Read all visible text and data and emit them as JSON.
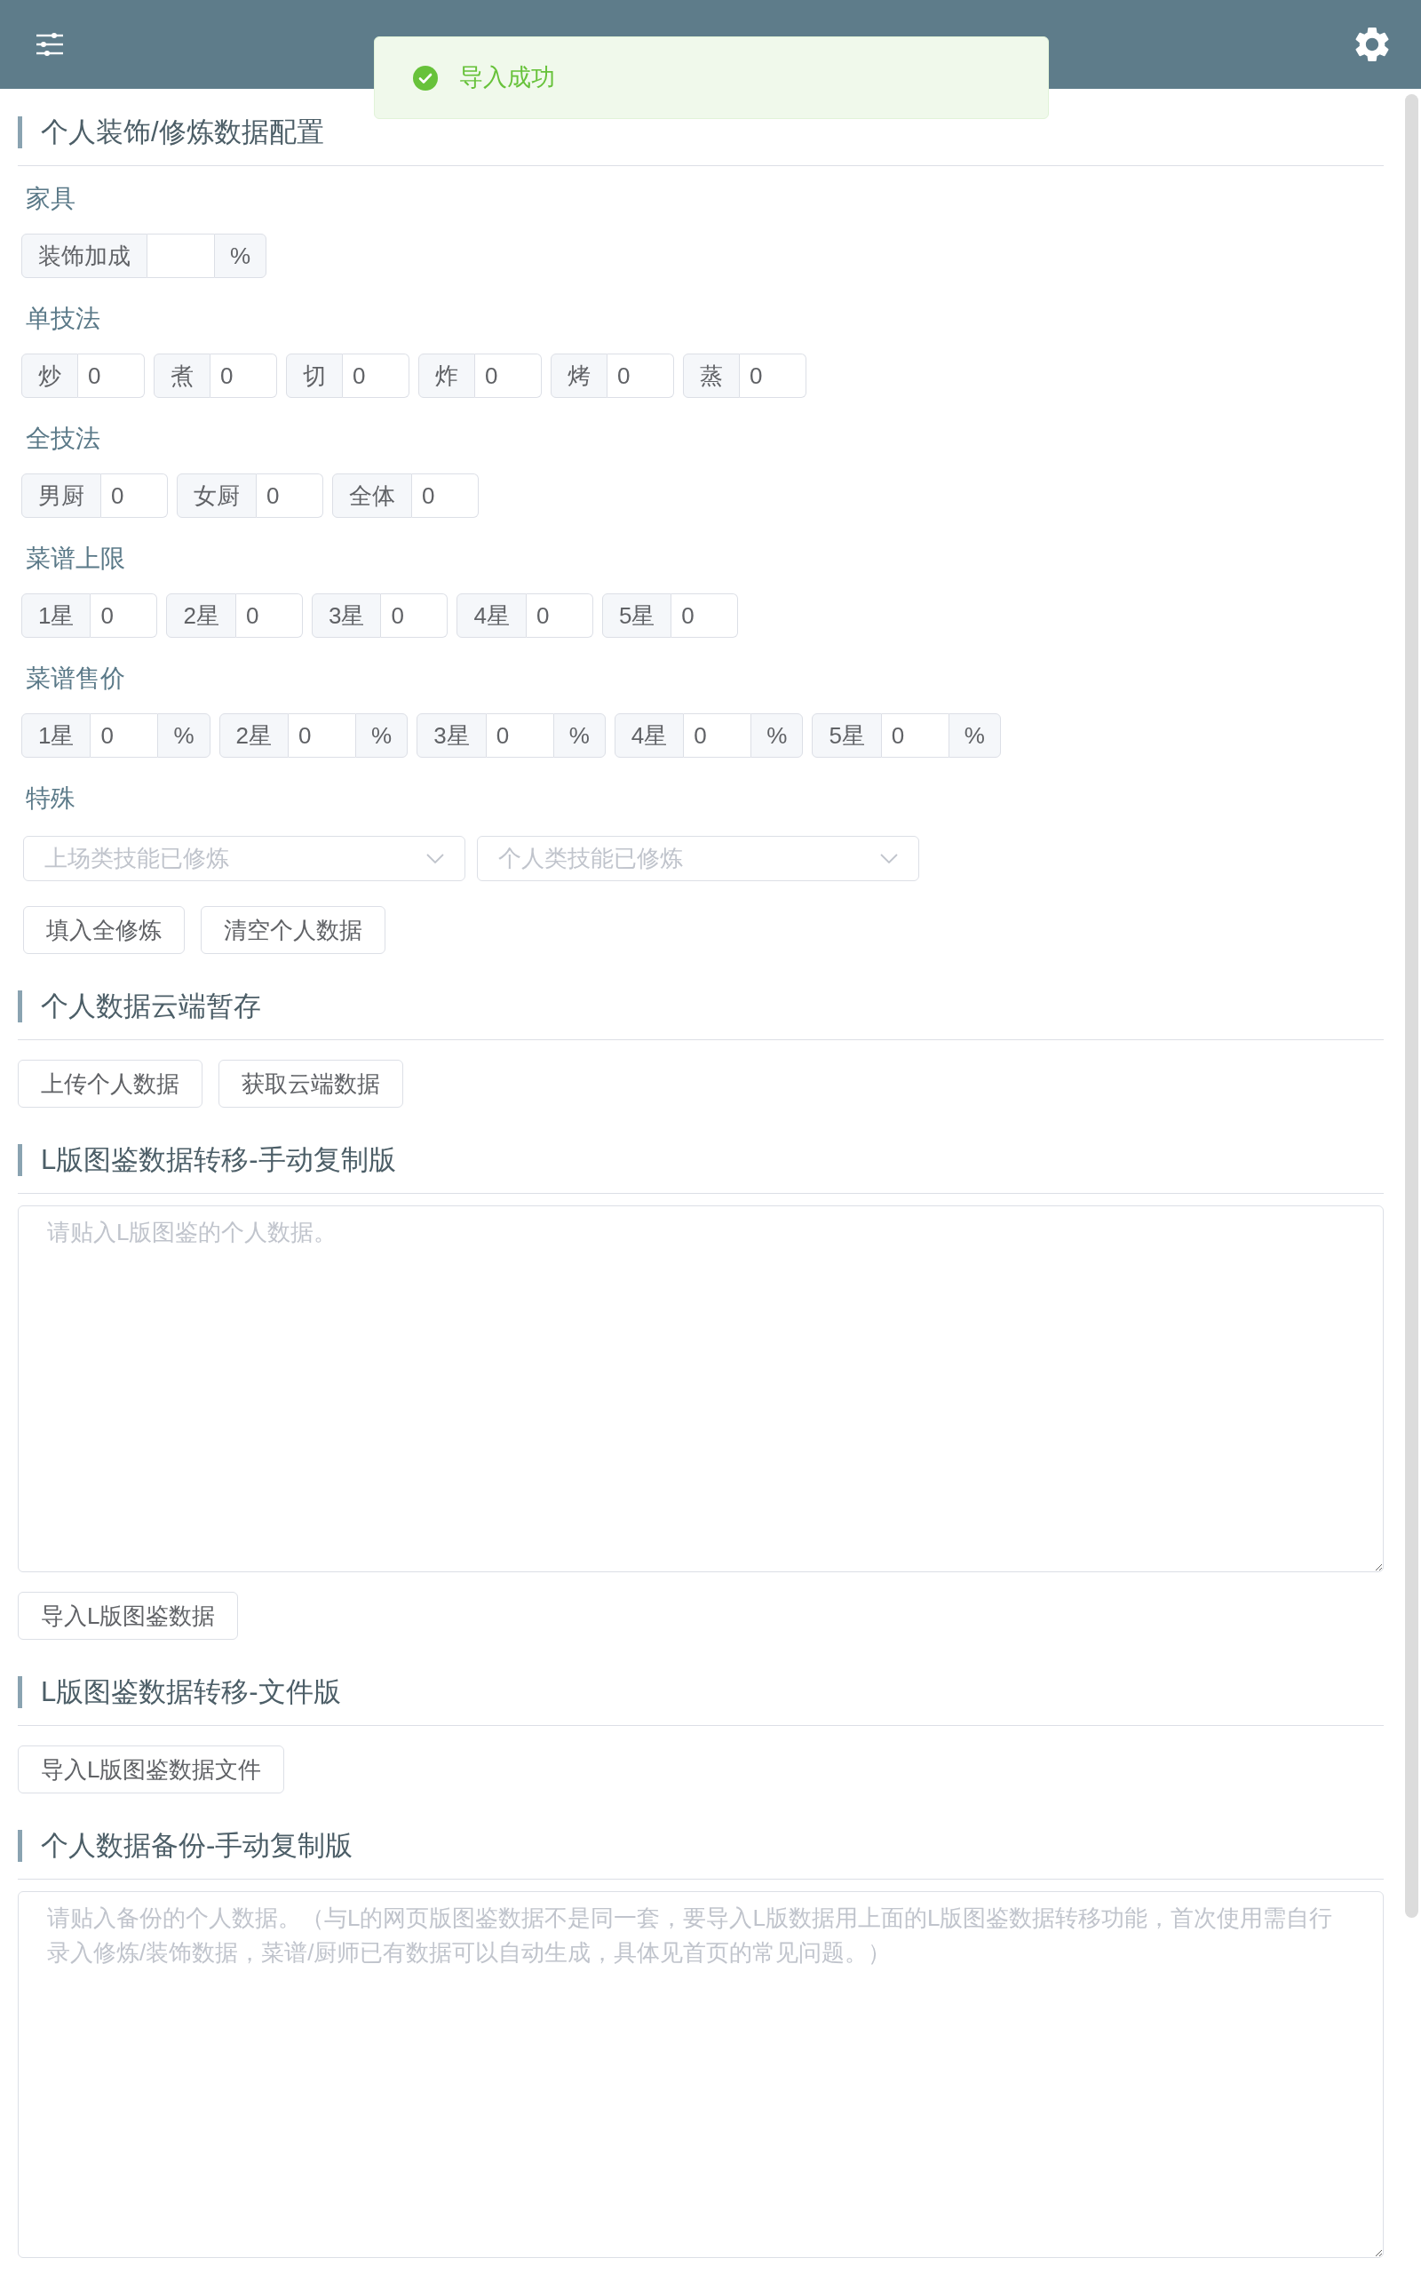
{
  "toast": {
    "kind": "success",
    "message": "导入成功"
  },
  "sections": [
    {
      "title": "个人装饰/修炼数据配置",
      "blocks": [
        {
          "kind": "fields",
          "label": "家具",
          "fields": [
            {
              "label": "装饰加成",
              "unit": "%"
            }
          ]
        },
        {
          "kind": "fields",
          "label": "单技法",
          "fields": [
            {
              "label": "炒",
              "value": "0"
            },
            {
              "label": "煮",
              "value": "0"
            },
            {
              "label": "切",
              "value": "0"
            },
            {
              "label": "炸",
              "value": "0"
            },
            {
              "label": "烤",
              "value": "0"
            },
            {
              "label": "蒸",
              "value": "0"
            }
          ]
        },
        {
          "kind": "fields",
          "label": "全技法",
          "fields": [
            {
              "label": "男厨",
              "value": "0"
            },
            {
              "label": "女厨",
              "value": "0"
            },
            {
              "label": "全体",
              "value": "0"
            }
          ]
        },
        {
          "kind": "fields",
          "label": "菜谱上限",
          "fields": [
            {
              "label": "1星",
              "value": "0"
            },
            {
              "label": "2星",
              "value": "0"
            },
            {
              "label": "3星",
              "value": "0"
            },
            {
              "label": "4星",
              "value": "0"
            },
            {
              "label": "5星",
              "value": "0"
            }
          ]
        },
        {
          "kind": "fields",
          "label": "菜谱售价",
          "fields": [
            {
              "label": "1星",
              "value": "0",
              "unit": "%"
            },
            {
              "label": "2星",
              "value": "0",
              "unit": "%"
            },
            {
              "label": "3星",
              "value": "0",
              "unit": "%"
            },
            {
              "label": "4星",
              "value": "0",
              "unit": "%"
            },
            {
              "label": "5星",
              "value": "0",
              "unit": "%"
            }
          ]
        },
        {
          "kind": "selects",
          "label": "特殊",
          "selects": [
            {
              "placeholder": "上场类技能已修炼"
            },
            {
              "placeholder": "个人类技能已修炼"
            }
          ]
        },
        {
          "kind": "buttons",
          "buttons": [
            "填入全修炼",
            "清空个人数据"
          ]
        }
      ]
    },
    {
      "title": "个人数据云端暂存",
      "blocks": [
        {
          "kind": "buttons",
          "buttons": [
            "上传个人数据",
            "获取云端数据"
          ]
        }
      ]
    },
    {
      "title": "L版图鉴数据转移-手动复制版",
      "blocks": [
        {
          "kind": "textarea",
          "placeholder": "请贴入L版图鉴的个人数据。"
        },
        {
          "kind": "buttons",
          "buttons": [
            "导入L版图鉴数据"
          ]
        }
      ]
    },
    {
      "title": "L版图鉴数据转移-文件版",
      "blocks": [
        {
          "kind": "buttons",
          "buttons": [
            "导入L版图鉴数据文件"
          ]
        }
      ]
    },
    {
      "title": "个人数据备份-手动复制版",
      "blocks": [
        {
          "kind": "textarea",
          "placeholder": "请贴入备份的个人数据。（与L的网页版图鉴数据不是同一套，要导入L版数据用上面的L版图鉴数据转移功能，首次使用需自行录入修炼/装饰数据，菜谱/厨师已有数据可以自动生成，具体见首页的常见问题。）"
        }
      ]
    }
  ]
}
